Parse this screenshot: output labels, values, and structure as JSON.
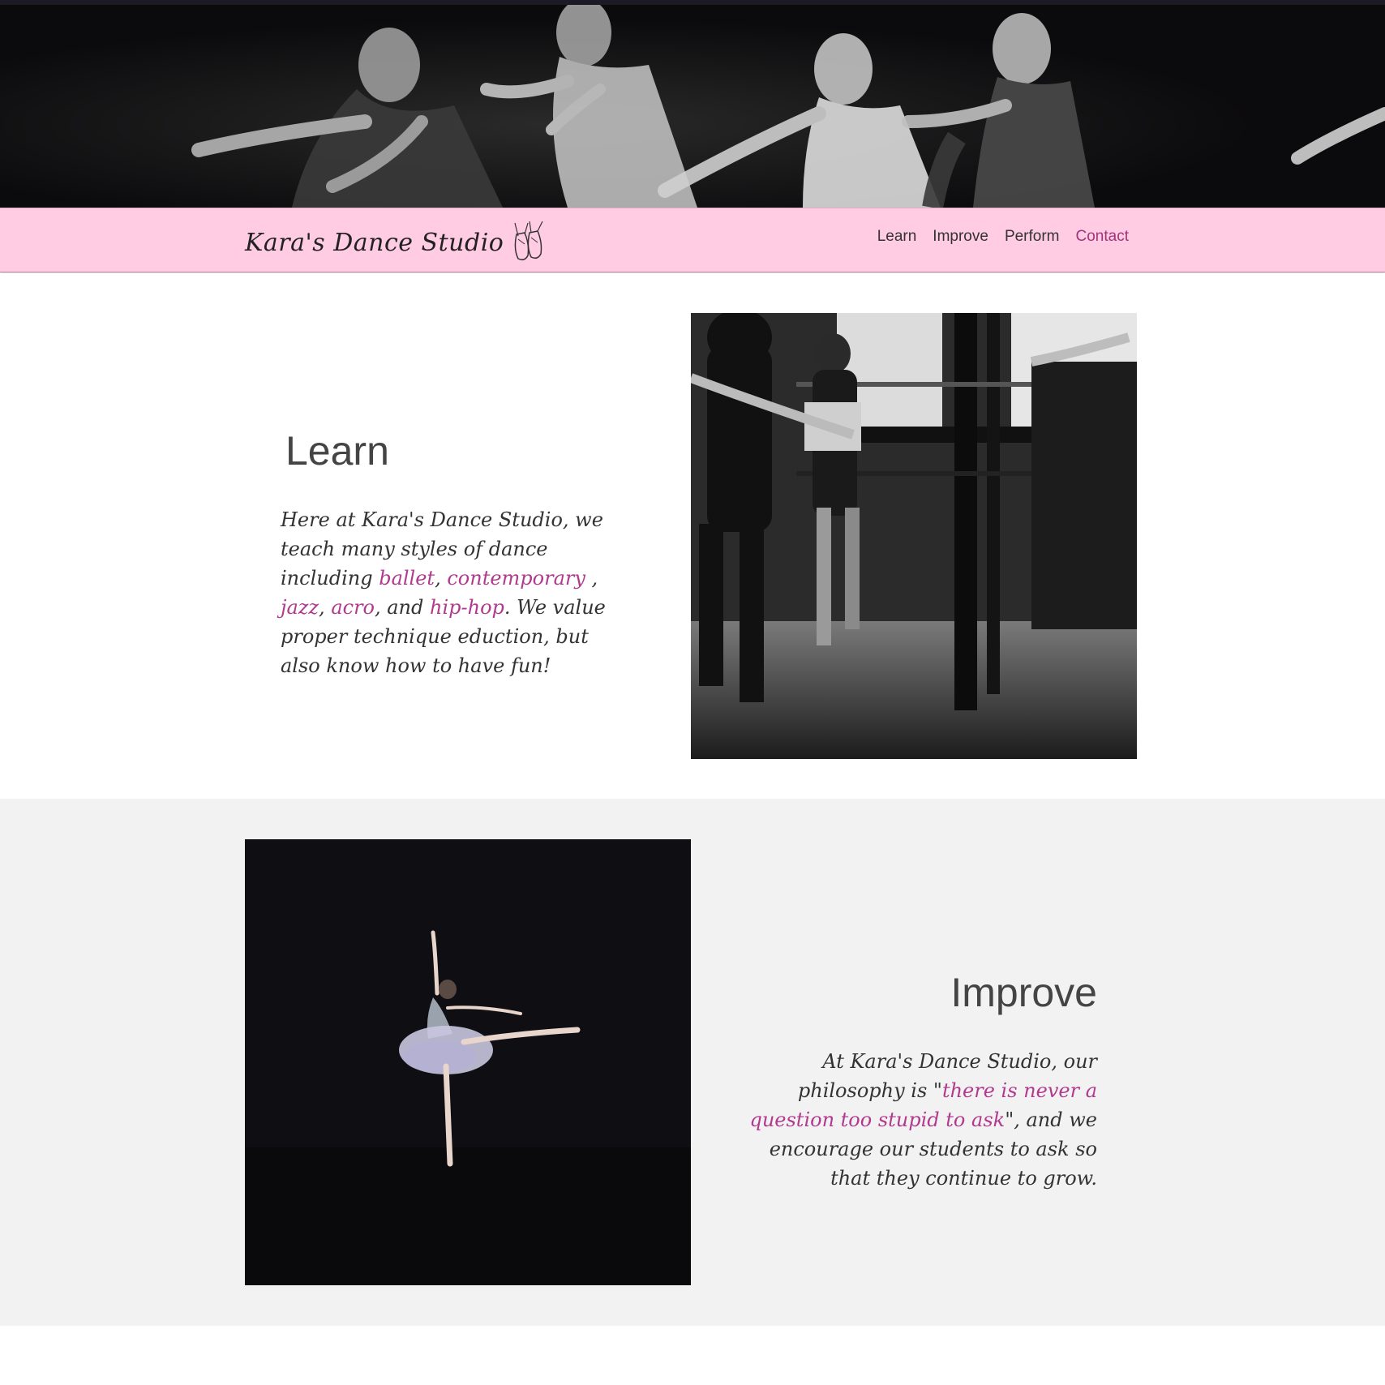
{
  "colors": {
    "nav_background": "#ffcce4",
    "accent": "#b23a8e",
    "active_link": "#a0347b",
    "section_alt_background": "#f2f2f2",
    "text": "#444444"
  },
  "header": {
    "banner_image": "dancers-black-and-white-photo",
    "brand_name": "Kara's Dance Studio",
    "brand_icon": "pointe-shoes-icon"
  },
  "nav": {
    "links": [
      {
        "label": "Learn",
        "active": false
      },
      {
        "label": "Improve",
        "active": false
      },
      {
        "label": "Perform",
        "active": false
      },
      {
        "label": "Contact",
        "active": true
      }
    ]
  },
  "learn": {
    "title": "Learn",
    "text_1": "Here at Kara's Dance Studio, we teach many styles of dance including ",
    "link_ballet": "ballet",
    "sep_1": ", ",
    "link_contemporary": "contemporary",
    "sep_2": " , ",
    "link_jazz": "jazz",
    "sep_3": ", ",
    "link_acro": "acro",
    "sep_4": ", and ",
    "link_hiphop": "hip-hop",
    "text_2": ". We value proper technique eduction, but also know how to have fun!",
    "image": "dancers-at-barre-photo"
  },
  "improve": {
    "title": "Improve",
    "text_1": "At Kara's Dance Studio, our philosophy is \"",
    "quote": "there is never a question too stupid to ask",
    "text_2": "\", and we encourage our students to ask so that they continue to grow.",
    "image": "ballerina-arabesque-photo"
  }
}
